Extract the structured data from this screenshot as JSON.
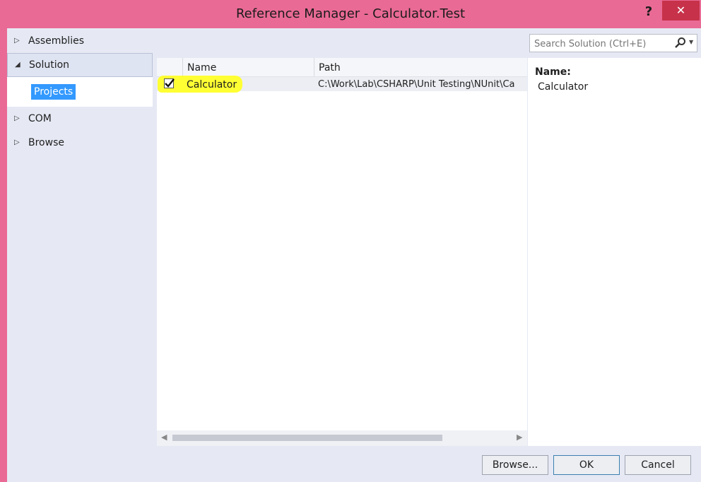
{
  "window": {
    "title": "Reference Manager - Calculator.Test"
  },
  "titlebar": {
    "help_label": "?",
    "close_label": "✕"
  },
  "nav": {
    "items": [
      {
        "label": "Assemblies"
      },
      {
        "label": "Solution"
      },
      {
        "label": "COM"
      },
      {
        "label": "Browse"
      }
    ],
    "selected_subitem": "Projects"
  },
  "grid": {
    "columns": [
      "Name",
      "Path"
    ],
    "rows": [
      {
        "checked": true,
        "name": "Calculator",
        "path": "C:\\Work\\Lab\\CSHARP\\Unit Testing\\NUnit\\Ca"
      }
    ]
  },
  "search": {
    "placeholder": "Search Solution (Ctrl+E)"
  },
  "details": {
    "name_label": "Name:",
    "name_value": "Calculator"
  },
  "buttons": {
    "browse": "Browse...",
    "ok": "OK",
    "cancel": "Cancel"
  },
  "colors": {
    "titlebar": "#e96a95",
    "close": "#c7324a",
    "selection": "#3399ff",
    "highlight": "#ffff33"
  }
}
